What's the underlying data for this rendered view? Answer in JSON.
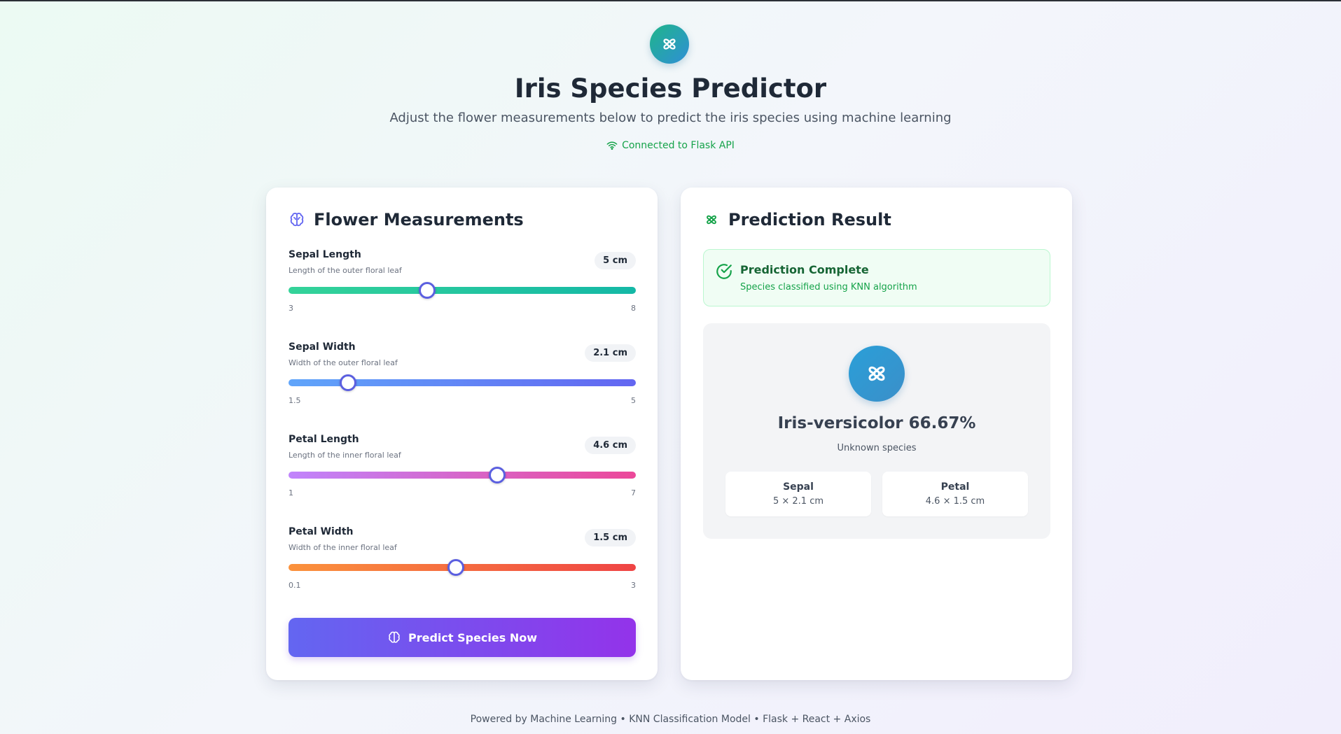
{
  "header": {
    "title": "Iris Species Predictor",
    "subtitle": "Adjust the flower measurements below to predict the iris species using machine learning",
    "connection_status": "Connected to Flask API",
    "logo_icon": "flower-icon"
  },
  "measurements": {
    "title": "Flower Measurements",
    "title_icon": "brain-icon",
    "sliders": [
      {
        "label": "Sepal Length",
        "description": "Length of the outer floral leaf",
        "value_text": "5 cm",
        "value": 5,
        "min": "3",
        "max": "8",
        "gradient": [
          "#34d399",
          "#14b8a6"
        ]
      },
      {
        "label": "Sepal Width",
        "description": "Width of the outer floral leaf",
        "value_text": "2.1 cm",
        "value": 2.1,
        "min": "1.5",
        "max": "5",
        "gradient": [
          "#60a5fa",
          "#6366f1"
        ]
      },
      {
        "label": "Petal Length",
        "description": "Length of the inner floral leaf",
        "value_text": "4.6 cm",
        "value": 4.6,
        "min": "1",
        "max": "7",
        "gradient": [
          "#c084fc",
          "#ec4899"
        ]
      },
      {
        "label": "Petal Width",
        "description": "Width of the inner floral leaf",
        "value_text": "1.5 cm",
        "value": 1.5,
        "min": "0.1",
        "max": "3",
        "gradient": [
          "#fb923c",
          "#ef4444"
        ]
      }
    ],
    "predict_button": "Predict Species Now"
  },
  "result": {
    "title": "Prediction Result",
    "status_title": "Prediction Complete",
    "status_subtitle": "Species classified using KNN algorithm",
    "species": "Iris-versicolor 66.67%",
    "species_note": "Unknown species",
    "sepal": {
      "label": "Sepal",
      "value": "5 × 2.1 cm"
    },
    "petal": {
      "label": "Petal",
      "value": "4.6 × 1.5 cm"
    }
  },
  "footer": {
    "text": "Powered by Machine Learning • KNN Classification Model • Flask + React + Axios"
  },
  "colors": {
    "accent": "#6366f1",
    "success": "#16a34a",
    "button_gradient": [
      "#6366f1",
      "#9333ea"
    ]
  }
}
